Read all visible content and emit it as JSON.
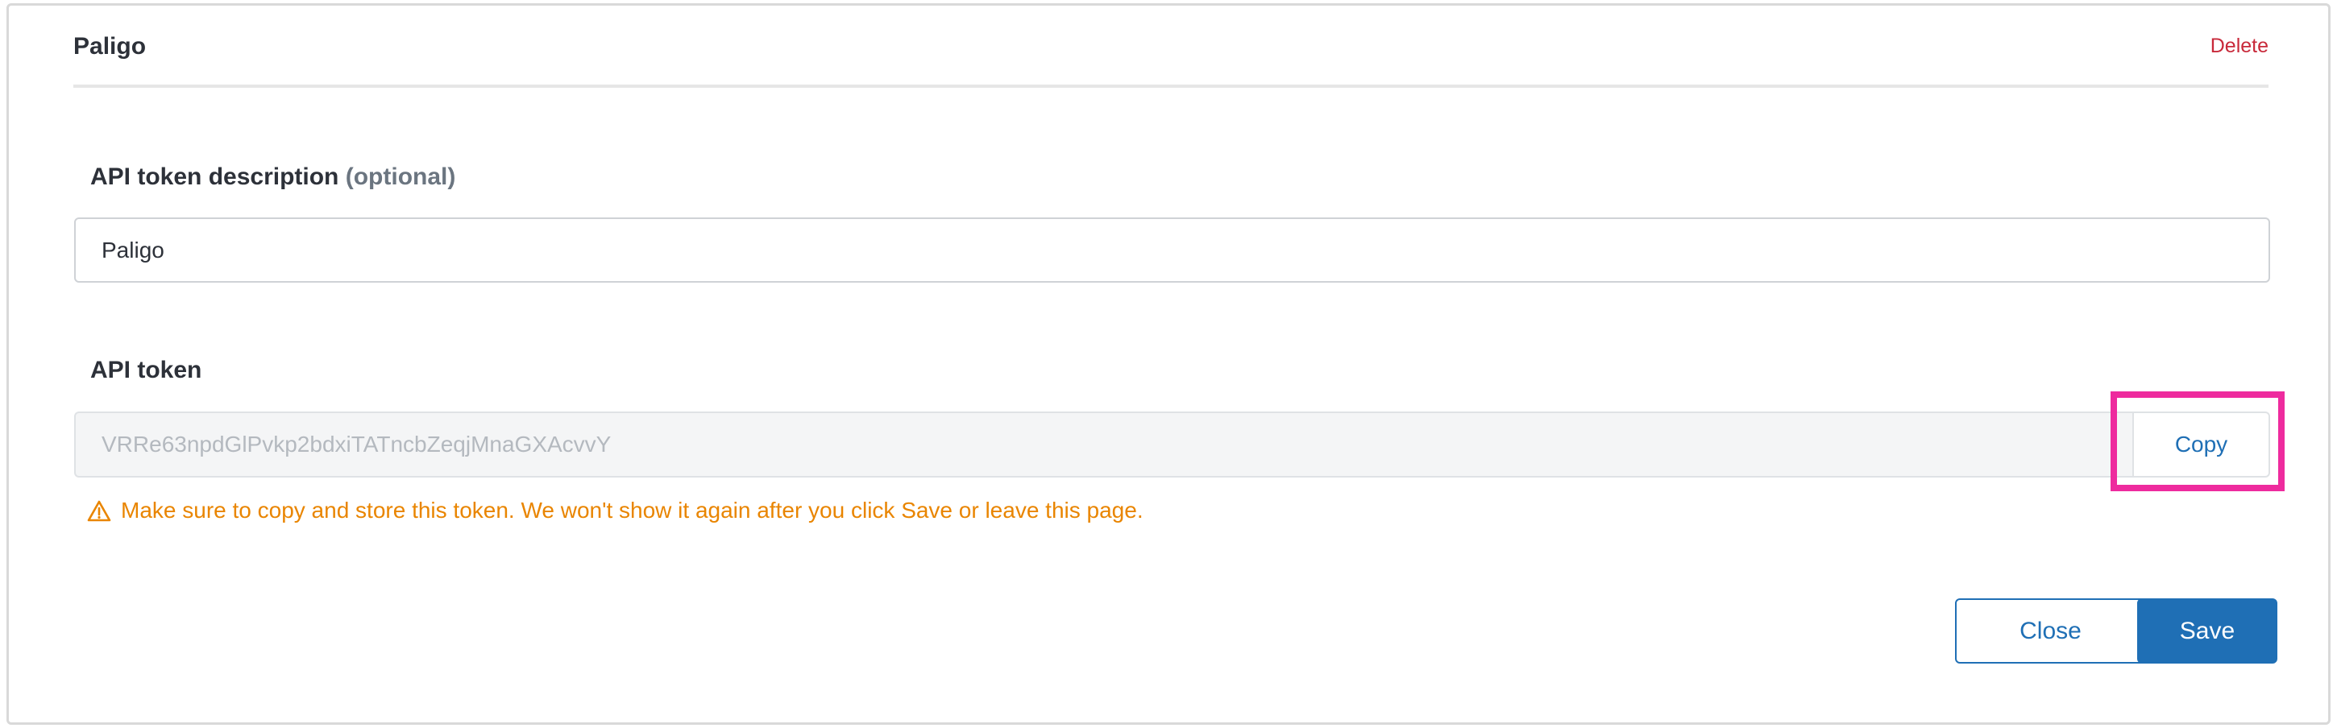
{
  "header": {
    "title": "Paligo",
    "delete_label": "Delete"
  },
  "description": {
    "label": "API token description",
    "optional_label": "(optional)",
    "value": "Paligo"
  },
  "token": {
    "label": "API token",
    "value": "VRRe63npdGlPvkp2bdxiTATncbZeqjMnaGXAcvvY",
    "copy_label": "Copy",
    "warning": "Make sure to copy and store this token. We won't show it again after you click Save or leave this page."
  },
  "footer": {
    "close_label": "Close",
    "save_label": "Save"
  },
  "colors": {
    "accent": "#1f6fb5",
    "danger": "#c8293a",
    "warning": "#e98500",
    "highlight": "#ee2b9e"
  }
}
